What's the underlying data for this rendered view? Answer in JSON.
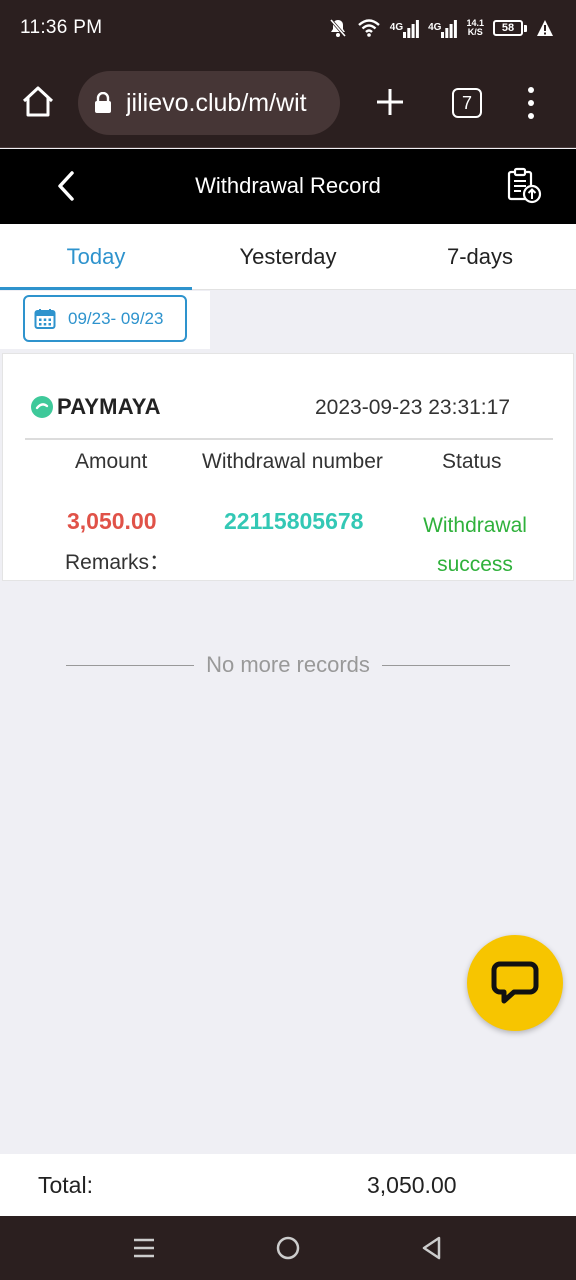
{
  "status_bar": {
    "time": "11:36 PM",
    "network_1": "4G",
    "network_2": "4G",
    "speed_value": "14.1",
    "speed_unit": "K/S",
    "battery": "58",
    "icons": [
      "mute-icon",
      "wifi-icon",
      "signal-icon",
      "signal-icon",
      "battery-icon",
      "alert-icon"
    ]
  },
  "browser": {
    "url": "jilievo.club/m/wit",
    "tab_count": "7"
  },
  "header": {
    "title": "Withdrawal Record"
  },
  "tabs": [
    {
      "label": "Today",
      "active": true
    },
    {
      "label": "Yesterday",
      "active": false
    },
    {
      "label": "7-days",
      "active": false
    }
  ],
  "date_filter": {
    "range": "09/23- 09/23"
  },
  "record": {
    "method": "PAYMAYA",
    "datetime": "2023-09-23 23:31:17",
    "headers": {
      "amount": "Amount",
      "number": "Withdrawal number",
      "status": "Status"
    },
    "amount": "3,050.00",
    "withdrawal_number": "22115805678",
    "status": "Withdrawal success",
    "remarks_label": "Remarks："
  },
  "footer_note": "No more records",
  "total": {
    "label": "Total:",
    "value": "3,050.00"
  },
  "colors": {
    "accent": "#2e93cd",
    "amount": "#e05248",
    "number": "#33c8b5",
    "success": "#2fb13b",
    "fab": "#f7c500"
  }
}
